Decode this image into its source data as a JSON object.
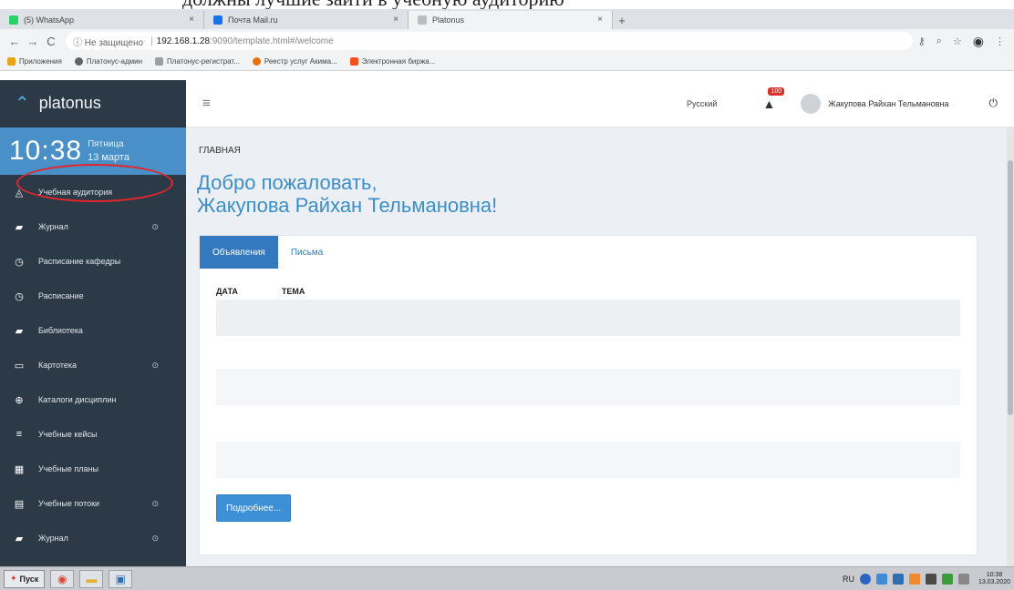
{
  "doc_strip": {
    "text": "должны лучшие зайти в учебную аудиторию"
  },
  "browser": {
    "tabs": [
      {
        "label": "(5) WhatsApp",
        "active": false,
        "color": "#25d366"
      },
      {
        "label": "Почта Mail.ru",
        "active": false,
        "color": "#1a73e8"
      },
      {
        "label": "Platonus",
        "active": true,
        "color": "#bdbdbd"
      }
    ],
    "new_tab": "+",
    "back": "←",
    "forward": "→",
    "reload": "C",
    "insecure_label": "ⓘ Не защищено",
    "url_host": "192.168.1.28",
    "url_path": ":9090/template.html#/welcome",
    "bookmarks": [
      {
        "label": "Приложения",
        "color": "#e8a317"
      },
      {
        "label": "Платонус-админ",
        "color": "#5f6368"
      },
      {
        "label": "Платонус-регистрат...",
        "color": "#9e9e9e"
      },
      {
        "label": "Реестр услуг Акима...",
        "color": "#e8700a"
      },
      {
        "label": "Электронная биржа...",
        "color": "#f4511e"
      }
    ]
  },
  "app": {
    "brand": "platonus",
    "clock": {
      "time": "10:38",
      "weekday": "Пятница",
      "date": "13 марта"
    },
    "menu": [
      {
        "label": "Учебная аудитория",
        "icon": "◬",
        "badge": "",
        "circled": true
      },
      {
        "label": "Журнал",
        "icon": "▰",
        "badge": "⊙",
        "circled": false
      },
      {
        "label": "Расписание кафедры",
        "icon": "◷",
        "badge": "",
        "circled": false
      },
      {
        "label": "Расписание",
        "icon": "◷",
        "badge": "",
        "circled": false
      },
      {
        "label": "Библиотека",
        "icon": "▰",
        "badge": "",
        "circled": false
      },
      {
        "label": "Картотека",
        "icon": "▭",
        "badge": "⊙",
        "circled": false
      },
      {
        "label": "Каталоги дисциплин",
        "icon": "⊕",
        "badge": "",
        "circled": false
      },
      {
        "label": "Учебные кейсы",
        "icon": "≡",
        "badge": "",
        "circled": false
      },
      {
        "label": "Учебные планы",
        "icon": "▦",
        "badge": "",
        "circled": false
      },
      {
        "label": "Учебные потоки",
        "icon": "▤",
        "badge": "⊙",
        "circled": false
      },
      {
        "label": "Журнал",
        "icon": "▰",
        "badge": "⊙",
        "circled": false
      }
    ],
    "header": {
      "language": "Русский",
      "notifications": "100",
      "user": "Жакупова Райхан Тельмановна"
    },
    "breadcrumb": "ГЛАВНАЯ",
    "welcome_line1": "Добро пожаловать,",
    "welcome_line2": "Жакупова Райхан Тельмановна!",
    "tabs": [
      "Объявления",
      "Письма"
    ],
    "table_headers": [
      "ДАТА",
      "ТЕМА"
    ],
    "more_button": "Подробнее..."
  },
  "taskbar": {
    "start": "Пуск",
    "lang": "RU",
    "time": "10:38",
    "date": "13.03.2020"
  }
}
